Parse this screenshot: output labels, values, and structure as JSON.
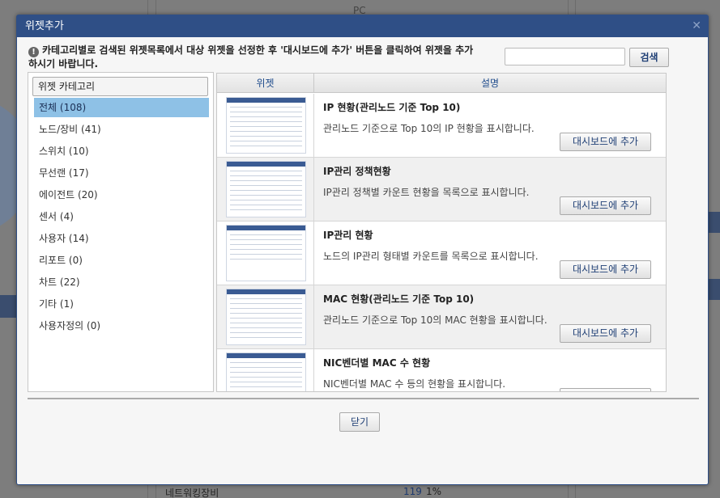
{
  "background": {
    "pc_label": "PC",
    "bottom_item": "네트워킹장비",
    "bottom_count": "119",
    "bottom_pct": "1%"
  },
  "dialog": {
    "title": "위젯추가",
    "close_icon": "close-icon",
    "description": "카테고리별로 검색된 위젯목록에서 대상 위젯을 선정한 후 '대시보드에 추가' 버튼을 클릭하여 위젯을 추가하시기 바랍니다.",
    "search": {
      "placeholder": "",
      "value": "",
      "button_label": "검색"
    },
    "close_button_label": "닫기"
  },
  "categories": {
    "header": "위젯 카테고리",
    "items": [
      {
        "label": "전체 (108)",
        "active": true
      },
      {
        "label": "노드/장비 (41)",
        "active": false
      },
      {
        "label": "스위치 (10)",
        "active": false
      },
      {
        "label": "무선랜 (17)",
        "active": false
      },
      {
        "label": "에이전트 (20)",
        "active": false
      },
      {
        "label": "센서 (4)",
        "active": false
      },
      {
        "label": "사용자 (14)",
        "active": false
      },
      {
        "label": "리포트 (0)",
        "active": false
      },
      {
        "label": "차트 (22)",
        "active": false
      },
      {
        "label": "기타 (1)",
        "active": false
      },
      {
        "label": "사용자정의 (0)",
        "active": false
      }
    ]
  },
  "table": {
    "columns": [
      "위젯",
      "설명"
    ],
    "add_button_label": "대시보드에 추가",
    "rows": [
      {
        "title": "IP 현황(관리노드 기준 Top 10)",
        "desc": "관리노드 기준으로 Top 10의 IP 현황을 표시합니다."
      },
      {
        "title": "IP관리 정책현황",
        "desc": "IP관리 정책별 카운트 현황을 목록으로 표시합니다."
      },
      {
        "title": "IP관리 현황",
        "desc": "노드의 IP관리 형태별 카운트를 목록으로 표시합니다."
      },
      {
        "title": "MAC 현황(관리노드 기준 Top 10)",
        "desc": "관리노드 기준으로 Top 10의 MAC 현황을 표시합니다."
      },
      {
        "title": "NIC벤더별 MAC 수 현황",
        "desc": "NIC벤더별 MAC 수 등의 현황을 표시합니다."
      }
    ]
  }
}
